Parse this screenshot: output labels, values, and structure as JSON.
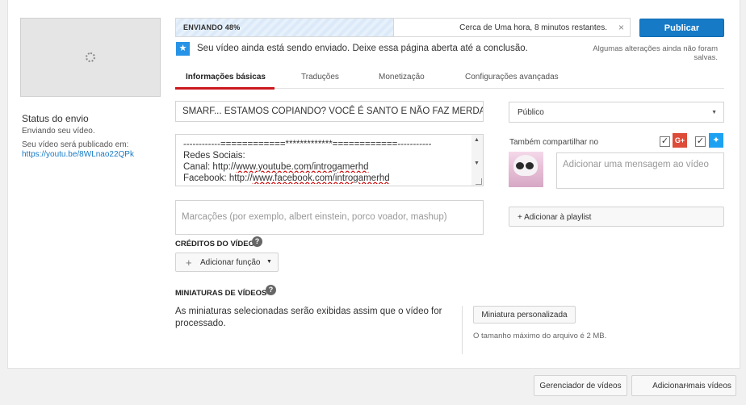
{
  "upload": {
    "progress_label": "ENVIANDO 48%",
    "progress_fraction": 0.48,
    "remaining": "Cerca de Uma hora, 8 minutos restantes.",
    "cancel_icon": "×",
    "publish_label": "Publicar",
    "unsaved_notice": "Algumas alterações ainda não foram salvas.",
    "notice_icon": "★",
    "notice_text": "Seu vídeo ainda está sendo enviado. Deixe essa página aberta até a conclusão."
  },
  "status": {
    "title": "Status do envio",
    "line": "Enviando seu vídeo.",
    "publish_label": "Seu vídeo será publicado em:",
    "url": "https://youtu.be/8WLnao22QPk"
  },
  "tabs": [
    {
      "label": "Informações básicas",
      "active": true
    },
    {
      "label": "Traduções",
      "active": false
    },
    {
      "label": "Monetização",
      "active": false
    },
    {
      "label": "Configurações avançadas",
      "active": false
    }
  ],
  "form": {
    "title_value": "SMARF... ESTAMOS COPIANDO? VOCÊ É SANTO E NÃO FAZ MERDA A",
    "description": {
      "line1": "------------============*************============-----------",
      "line2": "Redes Sociais:",
      "line3_prefix": "Canal: http://",
      "line3_link": "www.youtube.com/introgamerhd",
      "line4_prefix": "Facebook: http://",
      "line4_link": "www.facebook.com/introgamerhd"
    },
    "tags_placeholder": "Marcações (por exemplo, albert einstein, porco voador, mashup)",
    "credits_label": "CRÉDITOS DO VÍDEO",
    "add_role_label": "Adicionar função",
    "thumbnails_label": "MINIATURAS DE VÍDEOS",
    "thumbnails_text": "As miniaturas selecionadas serão exibidas assim que o vídeo for processado.",
    "custom_thumb_label": "Miniatura personalizada",
    "max_size_text": "O tamanho máximo do arquivo é 2 MB."
  },
  "sidebar": {
    "privacy_value": "Público",
    "share_label": "Também compartilhar no",
    "gplus_icon": "G+",
    "twitter_icon": "🐦",
    "gplus_checked": true,
    "twitter_checked": true,
    "message_placeholder": "Adicionar uma mensagem ao vídeo",
    "playlist_label": "+ Adicionar à playlist"
  },
  "footer": {
    "manager_label": "Gerenciador de vídeos",
    "add_more_label": "Adicionar mais vídeos"
  },
  "colors": {
    "accent": "#167ac6",
    "active_tab": "#cc181e",
    "gplus": "#dd4b39",
    "twitter": "#1da1f2"
  }
}
